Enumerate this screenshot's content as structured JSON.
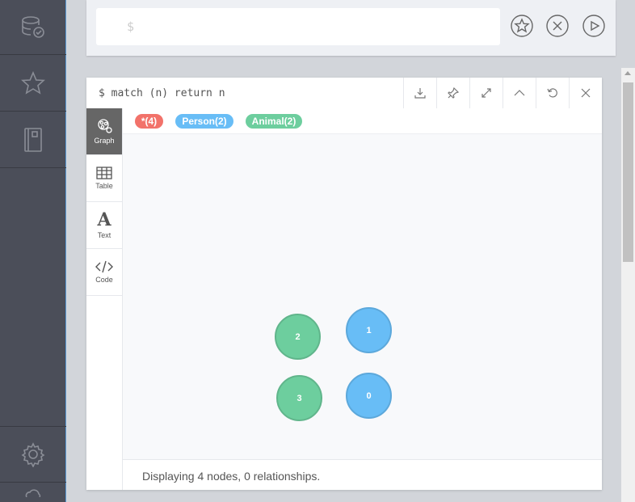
{
  "sidebar": {
    "items": [
      {
        "icon": "database-icon"
      },
      {
        "icon": "star-icon"
      },
      {
        "icon": "notebook-icon"
      }
    ],
    "bottom": [
      {
        "icon": "gear-icon"
      }
    ]
  },
  "editor": {
    "prompt": "$",
    "buttons": [
      "favorite-icon",
      "clear-icon",
      "run-icon"
    ]
  },
  "frame": {
    "query": "$ match (n) return n",
    "header_buttons": [
      "download-icon",
      "pin-icon",
      "fullscreen-icon",
      "collapse-icon",
      "rerun-icon",
      "close-icon"
    ],
    "view_tabs": [
      {
        "label": "Graph",
        "icon": "graph-icon",
        "active": true
      },
      {
        "label": "Table",
        "icon": "table-icon",
        "active": false
      },
      {
        "label": "Text",
        "icon": "text-icon",
        "active": false
      },
      {
        "label": "Code",
        "icon": "code-icon",
        "active": false
      }
    ],
    "legend": [
      {
        "label": "*(4)",
        "color": "#f2726a"
      },
      {
        "label": "Person(2)",
        "color": "#68bdf6"
      },
      {
        "label": "Animal(2)",
        "color": "#6dce9e"
      }
    ],
    "nodes": [
      {
        "id": "2",
        "label": "Animal",
        "color": "#6dce9e",
        "border": "#60b58b"
      },
      {
        "id": "1",
        "label": "Person",
        "color": "#68bdf6",
        "border": "#5ca8db"
      },
      {
        "id": "3",
        "label": "Animal",
        "color": "#6dce9e",
        "border": "#60b58b"
      },
      {
        "id": "0",
        "label": "Person",
        "color": "#68bdf6",
        "border": "#5ca8db"
      }
    ],
    "status": "Displaying 4 nodes, 0 relationships."
  }
}
